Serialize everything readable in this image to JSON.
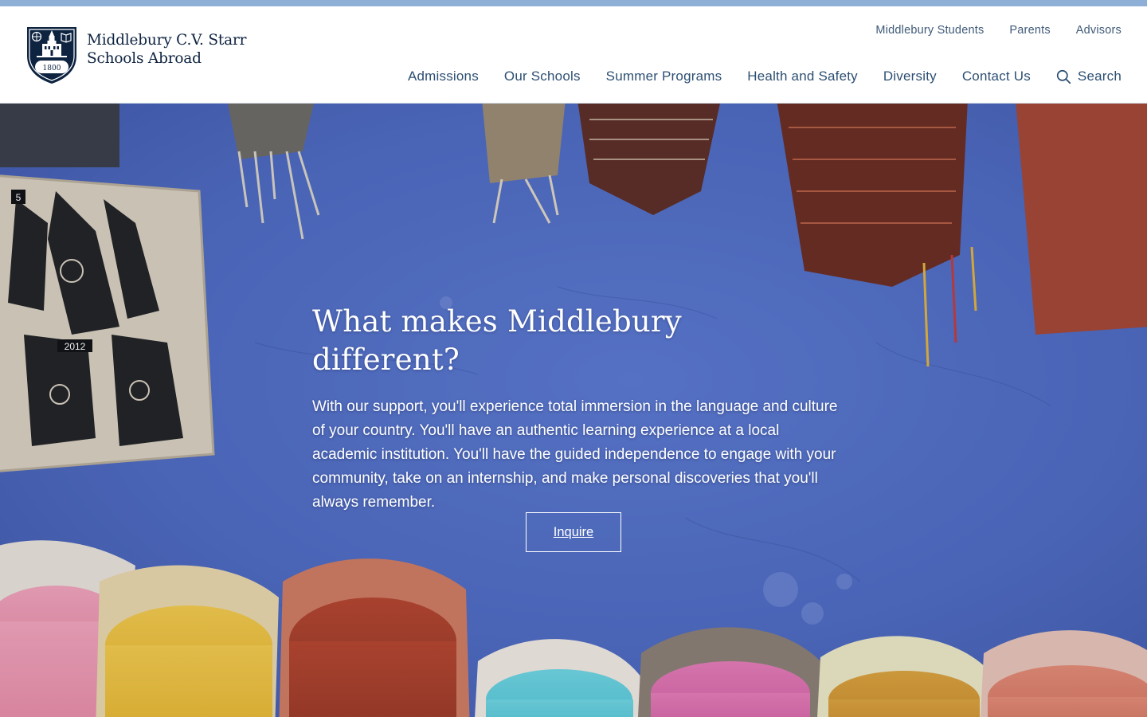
{
  "brand": {
    "line1": "Middlebury C.V. Starr",
    "line2": "Schools Abroad",
    "crest_year": "1800",
    "navy": "#0d2340"
  },
  "utility_nav": [
    "Middlebury Students",
    "Parents",
    "Advisors"
  ],
  "main_nav": [
    "Admissions",
    "Our Schools",
    "Summer Programs",
    "Health and Safety",
    "Diversity",
    "Contact Us"
  ],
  "search": {
    "label": "Search",
    "icon": "search-icon"
  },
  "hero": {
    "title": "What makes Middlebury different?",
    "body": "With our support, you'll experience total immersion in the language and culture of your country. You'll have an authentic learning experience at a local academic institution. You'll have the guided independence to engage with your community, take on an internship, and make personal discoveries that you'll always remember.",
    "cta_label": "Inquire",
    "henna_labels": [
      "5",
      "2012"
    ]
  },
  "colors": {
    "accent_strip": "#8eb0d6",
    "nav_text": "#2d4f73",
    "hero_wall": "#4f6bc0"
  }
}
